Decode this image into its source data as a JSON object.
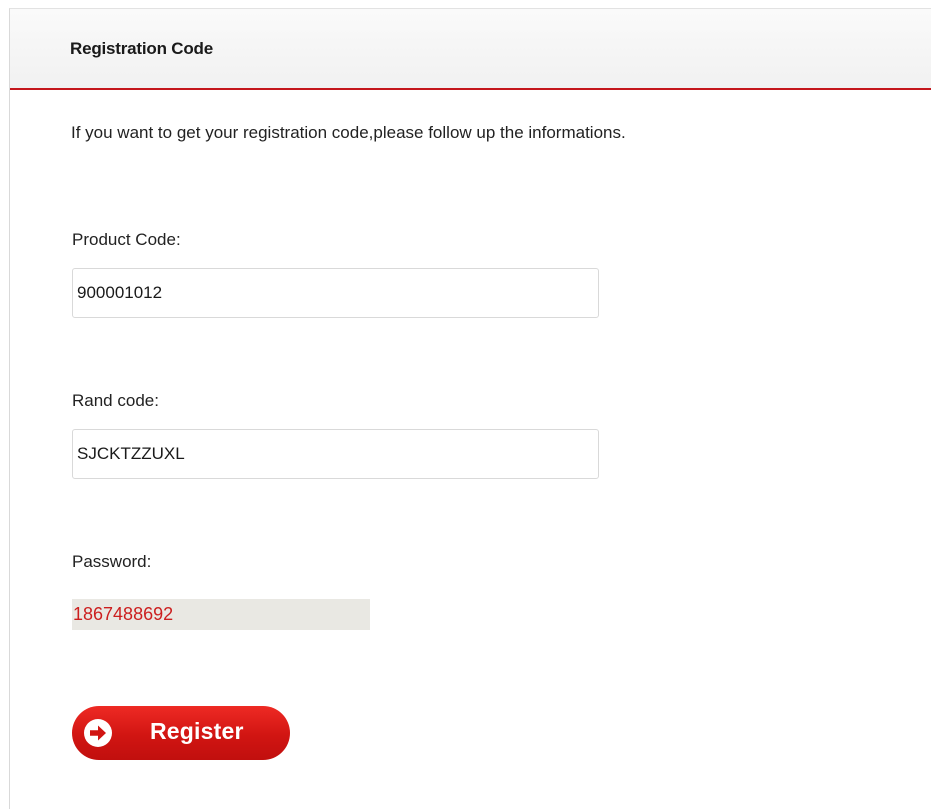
{
  "header": {
    "title": "Registration Code"
  },
  "intro_text": "If you want to get your registration code,please follow up the informations.",
  "form": {
    "product_code": {
      "label": "Product Code:",
      "value": "900001012"
    },
    "rand_code": {
      "label": "Rand code:",
      "value": "SJCKTZZUXL"
    },
    "password": {
      "label": "Password:",
      "value": "1867488692"
    },
    "register_button": {
      "label": "Register",
      "icon": "arrow-right-circle-icon"
    }
  },
  "colors": {
    "accent_red": "#c4161c",
    "password_text": "#cc1f1f",
    "password_background": "#e9e8e3"
  }
}
